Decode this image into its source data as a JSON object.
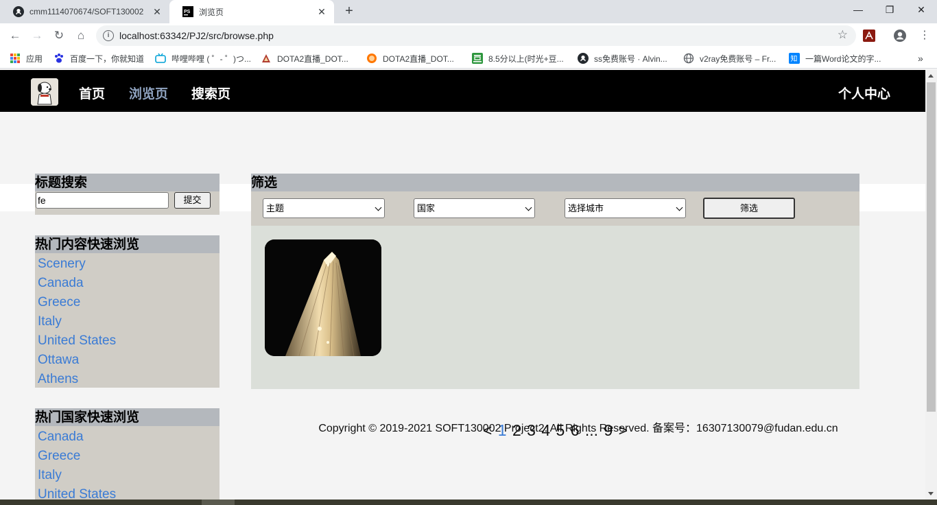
{
  "browser": {
    "tabs": [
      {
        "title": "cmm1114070674/SOFT130002",
        "icon": "github-icon"
      },
      {
        "title": "浏览页",
        "icon": "phpstorm-icon"
      }
    ],
    "new_tab": "+",
    "address": "localhost:63342/PJ2/src/browse.php",
    "bookmarks": [
      {
        "label": "应用",
        "icon": "apps-grid-icon"
      },
      {
        "label": "百度一下，你就知道",
        "icon": "baidu-paw-icon"
      },
      {
        "label": "哔哩哔哩 ( ゜- ゜)つ...",
        "icon": "bilibili-icon"
      },
      {
        "label": "DOTA2直播_DOT...",
        "icon": "dota-icon"
      },
      {
        "label": "DOTA2直播_DOT...",
        "icon": "douyu-icon"
      },
      {
        "label": "8.5分以上(时光+豆...",
        "icon": "douban-icon"
      },
      {
        "label": "ss免费账号 · Alvin...",
        "icon": "github-icon"
      },
      {
        "label": "v2ray免费账号 – Fr...",
        "icon": "globe-icon"
      },
      {
        "label": "一篇Word论文的字...",
        "icon": "zhihu-icon"
      }
    ],
    "more_bookmarks": "»"
  },
  "site": {
    "nav": {
      "home": "首页",
      "browse": "浏览页",
      "search": "搜索页",
      "profile": "个人中心"
    },
    "title_search": {
      "heading": "标题搜索",
      "value": "fe",
      "submit": "提交"
    },
    "hot_content": {
      "heading": "热门内容快速浏览",
      "items": [
        "Scenery",
        "Canada",
        "Greece",
        "Italy",
        "United States",
        "Ottawa",
        "Athens"
      ]
    },
    "hot_countries": {
      "heading": "热门国家快速浏览",
      "items": [
        "Canada",
        "Greece",
        "Italy",
        "United States"
      ]
    },
    "filter": {
      "heading": "筛选",
      "theme": "主题",
      "country": "国家",
      "city": "选择城市",
      "button": "筛选"
    },
    "pager": {
      "prev": "<",
      "pages": [
        "1",
        "2",
        "3",
        "4",
        "5",
        "6"
      ],
      "ellipsis": "...",
      "last": "9",
      "next": ">",
      "current": "1"
    },
    "copyright": "Copyright © 2019-2021 SOFT130002 Project2. All Rights Reserved. 备案号：16307130079@fudan.edu.cn"
  },
  "colors": {
    "nav_bg": "#000000",
    "nav_active": "#8fa3c0",
    "link": "#3a7bd5",
    "panel_head": "#b4b8bd",
    "panel_body": "#d0cdc6",
    "results_bg": "#dbdfd9"
  }
}
